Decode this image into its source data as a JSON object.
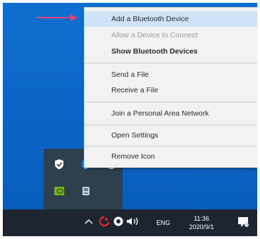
{
  "context_menu": {
    "items": [
      {
        "label": "Add a Bluetooth Device",
        "state": "highlighted"
      },
      {
        "label": "Allow a Device to Connect",
        "state": "disabled"
      },
      {
        "label": "Show Bluetooth Devices",
        "state": "bold"
      },
      {
        "label": "Send a File",
        "state": "normal"
      },
      {
        "label": "Receive a File",
        "state": "normal"
      },
      {
        "label": "Join a Personal Area Network",
        "state": "normal"
      },
      {
        "label": "Open Settings",
        "state": "normal"
      },
      {
        "label": "Remove Icon",
        "state": "normal"
      }
    ],
    "highlight_color": "#cfe3f7"
  },
  "pointer_arrow": {
    "color": "#e0447a"
  },
  "taskbar": {
    "language": "ENG",
    "time": "11:36",
    "date": "2020/9/1",
    "background": "#1d2630"
  },
  "icons": {
    "tray_flyout": [
      "defender-shield-icon",
      "bluetooth-icon",
      "power-icon",
      "nvidia-icon",
      "usb-device-icon"
    ],
    "taskbar": [
      "show-hidden-icons-chevron",
      "antivirus-icon",
      "network-icon",
      "volume-icon",
      "notification-icon"
    ]
  }
}
